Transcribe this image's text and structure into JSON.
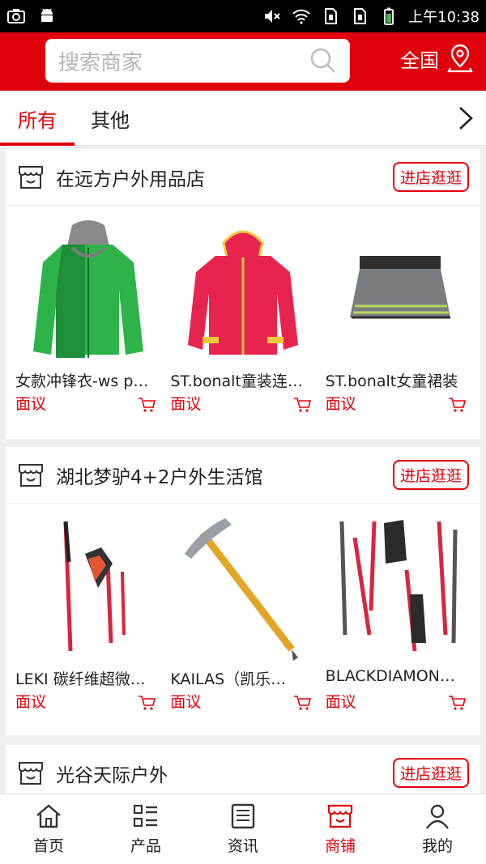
{
  "status_bar": {
    "time": "上午10:38"
  },
  "header": {
    "search_placeholder": "搜索商家",
    "region": "全国"
  },
  "tabs": [
    {
      "label": "所有"
    },
    {
      "label": "其他"
    }
  ],
  "shops": [
    {
      "name": "在远方户外用品店",
      "visit_label": "进店逛逛",
      "products": [
        {
          "name": "女款冲锋衣-ws p…",
          "price": "面议"
        },
        {
          "name": "ST.bonalt童装连…",
          "price": "面议"
        },
        {
          "name": "ST.bonalt女童裙装",
          "price": "面议"
        }
      ]
    },
    {
      "name": "湖北梦驴4+2户外生活馆",
      "visit_label": "进店逛逛",
      "products": [
        {
          "name": "LEKI 碳纤维超微…",
          "price": "面议"
        },
        {
          "name": "KAILAS（凯乐…",
          "price": "面议"
        },
        {
          "name": "BLACKDIAMON…",
          "price": "面议"
        }
      ]
    },
    {
      "name": "光谷天际户外",
      "visit_label": "进店逛逛",
      "products": []
    }
  ],
  "bottom_nav": [
    {
      "label": "首页",
      "icon": "home-icon"
    },
    {
      "label": "产品",
      "icon": "grid-list-icon"
    },
    {
      "label": "资讯",
      "icon": "news-icon"
    },
    {
      "label": "商铺",
      "icon": "store-icon"
    },
    {
      "label": "我的",
      "icon": "user-icon"
    }
  ],
  "colors": {
    "accent": "#e0000b",
    "background": "#efefef"
  }
}
